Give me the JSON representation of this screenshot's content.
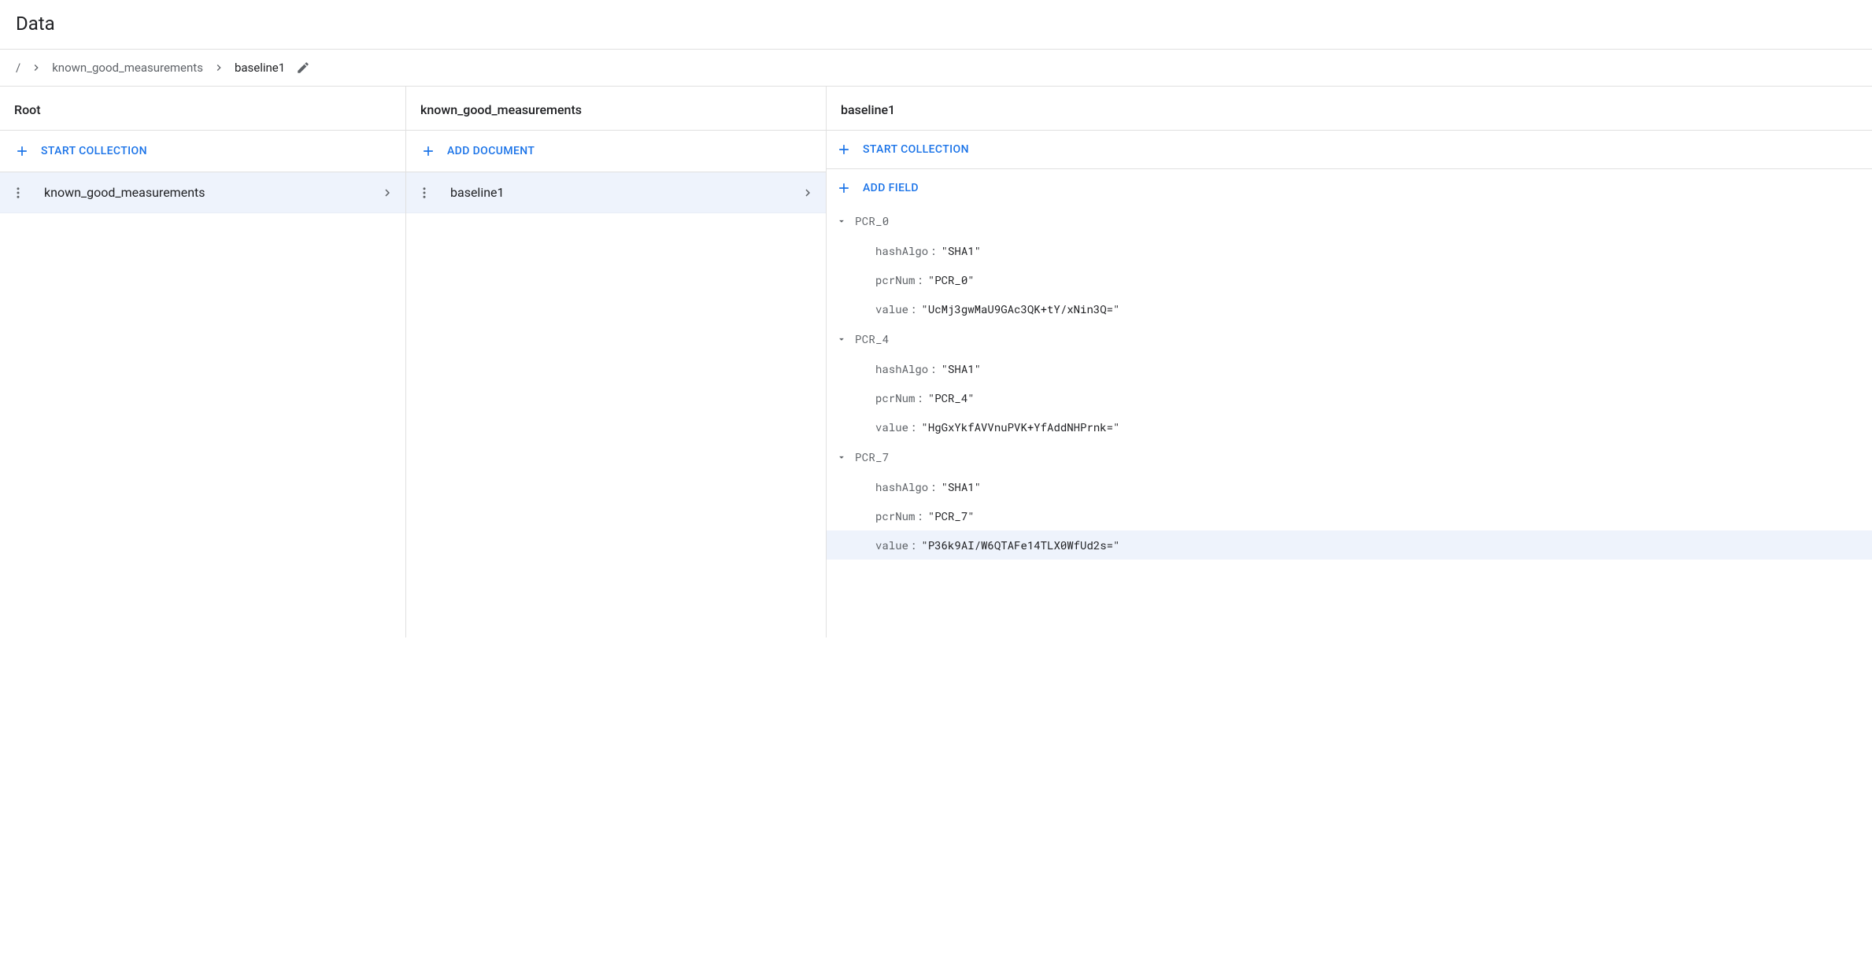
{
  "title": "Data",
  "breadcrumb": {
    "root": "/",
    "collection": "known_good_measurements",
    "document": "baseline1"
  },
  "columns": {
    "root": {
      "header": "Root",
      "action": "START COLLECTION",
      "items": [
        {
          "label": "known_good_measurements"
        }
      ]
    },
    "collection": {
      "header": "known_good_measurements",
      "action": "ADD DOCUMENT",
      "items": [
        {
          "label": "baseline1"
        }
      ]
    },
    "document": {
      "header": "baseline1",
      "action_collection": "START COLLECTION",
      "action_field": "ADD FIELD",
      "fields": [
        {
          "name": "PCR_0",
          "props": [
            {
              "key": "hashAlgo",
              "value": "\"SHA1\""
            },
            {
              "key": "pcrNum",
              "value": "\"PCR_0\""
            },
            {
              "key": "value",
              "value": "\"UcMj3gwMaU9GAc3QK+tY/xNin3Q=\""
            }
          ]
        },
        {
          "name": "PCR_4",
          "props": [
            {
              "key": "hashAlgo",
              "value": "\"SHA1\""
            },
            {
              "key": "pcrNum",
              "value": "\"PCR_4\""
            },
            {
              "key": "value",
              "value": "\"HgGxYkfAVVnuPVK+YfAddNHPrnk=\""
            }
          ]
        },
        {
          "name": "PCR_7",
          "props": [
            {
              "key": "hashAlgo",
              "value": "\"SHA1\""
            },
            {
              "key": "pcrNum",
              "value": "\"PCR_7\""
            },
            {
              "key": "value",
              "value": "\"P36k9AI/W6QTAFe14TLX0WfUd2s=\"",
              "highlight": true
            }
          ]
        }
      ]
    }
  }
}
